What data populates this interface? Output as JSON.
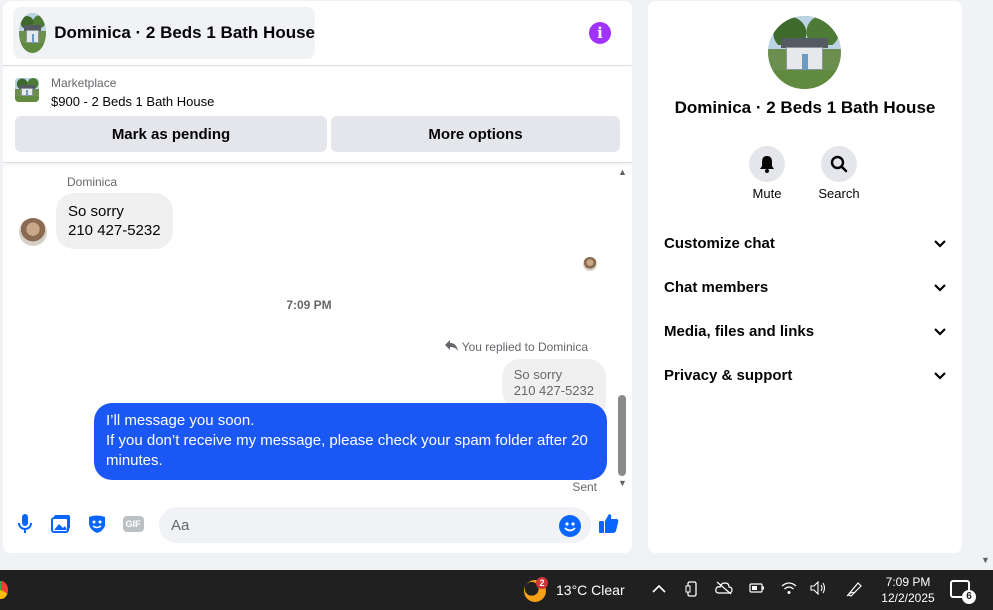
{
  "chat": {
    "title": "Dominica · 2 Beds 1 Bath House",
    "listing": {
      "source": "Marketplace",
      "price_title": "$900 - 2 Beds 1 Bath House",
      "pending_label": "Mark as pending",
      "more_label": "More options"
    },
    "messages": {
      "sender_name": "Dominica",
      "received_lines": [
        "So sorry",
        "210 427-5232"
      ],
      "timestamp": "7:09 PM",
      "replied_note": "You replied to Dominica",
      "quoted_lines": [
        "So sorry",
        "210 427-5232"
      ],
      "sent_lines": [
        "I’ll message you soon.",
        "If you don’t receive my message, please check your spam folder after 20 minutes."
      ],
      "sent_status": "Sent"
    },
    "composer": {
      "placeholder": "Aa",
      "gif_label": "GIF"
    },
    "colors": {
      "accent": "#0866ff",
      "sent_bubble": "#1a57f5",
      "info": "#a033ff"
    }
  },
  "info_panel": {
    "title": "Dominica · 2 Beds 1 Bath House",
    "actions": {
      "mute": "Mute",
      "search": "Search"
    },
    "sections": {
      "customize": "Customize chat",
      "members": "Chat members",
      "media": "Media, files and links",
      "privacy": "Privacy & support"
    }
  },
  "taskbar": {
    "weather_badge": "2",
    "weather": "13°C  Clear",
    "time": "7:09 PM",
    "date": "12/2/2025",
    "notification_count": "6"
  }
}
